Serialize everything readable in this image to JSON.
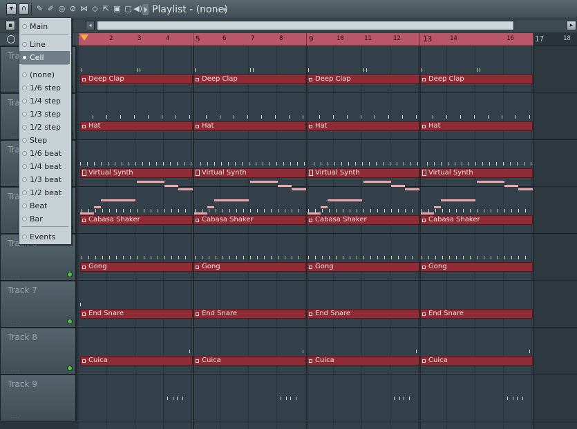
{
  "window": {
    "title": "Playlist - (none)"
  },
  "ruler": {
    "labels": [
      "2",
      "3",
      "4",
      "5",
      "6",
      "7",
      "8",
      "9",
      "10",
      "11",
      "12",
      "13",
      "14",
      "16",
      "17",
      "18"
    ]
  },
  "snap_menu": {
    "items": [
      {
        "label": "Main",
        "selected": false
      },
      {
        "label": "Line",
        "selected": false
      },
      {
        "label": "Cell",
        "selected": true
      },
      {
        "label": "(none)",
        "selected": false
      },
      {
        "label": "1/6 step",
        "selected": false
      },
      {
        "label": "1/4 step",
        "selected": false
      },
      {
        "label": "1/3 step",
        "selected": false
      },
      {
        "label": "1/2 step",
        "selected": false
      },
      {
        "label": "Step",
        "selected": false
      },
      {
        "label": "1/6 beat",
        "selected": false
      },
      {
        "label": "1/4 beat",
        "selected": false
      },
      {
        "label": "1/3 beat",
        "selected": false
      },
      {
        "label": "1/2 beat",
        "selected": false
      },
      {
        "label": "Beat",
        "selected": false
      },
      {
        "label": "Bar",
        "selected": false
      },
      {
        "label": "Events",
        "selected": false
      }
    ]
  },
  "tracks": [
    {
      "name": "Track",
      "pattern": "Deep Clap"
    },
    {
      "name": "Track",
      "pattern": "Hat"
    },
    {
      "name": "Track",
      "pattern": "Virtual Synth"
    },
    {
      "name": "Track",
      "pattern": "Cabasa Shaker"
    },
    {
      "name": "Track 6",
      "pattern": "Gong"
    },
    {
      "name": "Track 7",
      "pattern": "End Snare"
    },
    {
      "name": "Track 8",
      "pattern": "Cuica"
    },
    {
      "name": "Track 9",
      "pattern": ""
    }
  ],
  "colors": {
    "clip": "#8e2b35",
    "ruler": "#b9566a",
    "note": "#f0a7ab",
    "marker": "#f2b23a"
  }
}
